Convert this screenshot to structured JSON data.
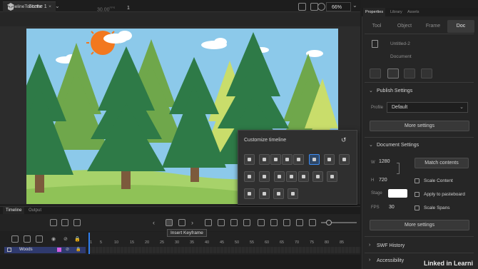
{
  "document_tab": {
    "title": "TimelineTools.fla",
    "close": "×"
  },
  "edit_bar": {
    "scene": "Scene 1",
    "zoom": "66%"
  },
  "popup": {
    "title": "Customize timeline",
    "reset_icon": "reset-icon",
    "row1": [
      "chevron-left-icon",
      "keyframe-icon",
      "blank-keyframe-icon",
      "frame-icon",
      "text-icon",
      "insert-keyframe-icon",
      "blank-frame-icon",
      "chevron-right-icon"
    ],
    "row2": [
      "onion-skin-icon",
      "edit-multiple-icon",
      "loop-icon",
      "clear-icon",
      "center-icon",
      "copy-icon",
      "paste-icon"
    ],
    "row3": [
      "loop-playback-icon",
      "step-back-icon",
      "play-icon",
      "step-forward-icon"
    ]
  },
  "timeline": {
    "tabs": {
      "timeline": "Timeline",
      "output": "Output"
    },
    "fps": "30.00",
    "fps_unit": "FPS",
    "frame": "1",
    "tooltip": "Insert Keyframe",
    "ruler": [
      "1",
      "5",
      "10",
      "15",
      "20",
      "25",
      "30",
      "35",
      "40",
      "45",
      "50",
      "55",
      "60",
      "65",
      "70",
      "75",
      "80",
      "85"
    ],
    "layer_name": "Woods"
  },
  "properties": {
    "tabs": {
      "properties": "Properties",
      "library": "Library",
      "assets": "Assets"
    },
    "subtabs": {
      "tool": "Tool",
      "object": "Object",
      "frame": "Frame",
      "doc": "Doc"
    },
    "doc_name": "Untitled-2",
    "doc_type": "Document",
    "publish": {
      "title": "Publish Settings",
      "profile_label": "Profile",
      "profile_value": "Default",
      "more_button": "More settings"
    },
    "document_settings": {
      "title": "Document Settings",
      "w_label": "W",
      "w_value": "1280",
      "h_label": "H",
      "h_value": "720",
      "match_button": "Match contents",
      "scale_content": "Scale Content",
      "stage_label": "Stage",
      "apply_pasteboard": "Apply to pasteboard",
      "fps_label": "FPS",
      "fps_value": "30",
      "scale_spans": "Scale Spans",
      "more_button": "More settings"
    },
    "swf_history": "SWF History",
    "accessibility": "Accessibility"
  },
  "watermark": "Linked in Learni",
  "colors": {
    "accent": "#2f7ff0",
    "sky": "#8cc9ea",
    "grass": "#a7d26a",
    "tree_dark": "#2e7a47",
    "sun": "#f2781f"
  }
}
